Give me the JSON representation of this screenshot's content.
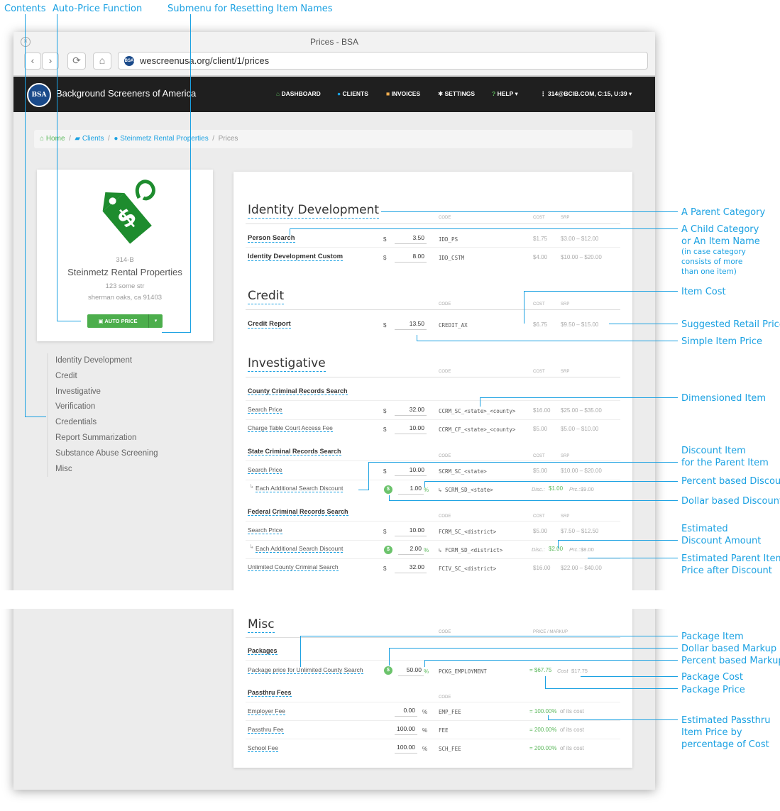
{
  "annotations_top": {
    "contents": "Contents",
    "auto_price": "Auto-Price Function",
    "submenu": "Submenu for Resetting Item Names"
  },
  "annotations_right": {
    "parent_category": "A Parent Category",
    "child_category_1": "A Child Category",
    "child_category_2": "or An Item Name",
    "child_note_1": "(in case category",
    "child_note_2": "consists of more",
    "child_note_3": "than one item)",
    "item_cost": "Item Cost",
    "srp": "Suggested Retail Price",
    "simple_price": "Simple Item Price",
    "dimensioned": "Dimensioned Item",
    "discount_item_1": "Discount Item",
    "discount_item_2": "for the Parent Item",
    "percent_discount": "Percent based Discount",
    "dollar_discount": "Dollar based Discount",
    "est_discount_1": "Estimated",
    "est_discount_2": "Discount Amount",
    "est_parent_1": "Estimated Parent Item",
    "est_parent_2": "Price after Discount",
    "package_item": "Package Item",
    "dollar_markup": "Dollar based Markup",
    "percent_markup": "Percent based Markup",
    "package_cost": "Package Cost",
    "package_price": "Package Price",
    "est_passthru_1": "Estimated Passthru",
    "est_passthru_2": "Item Price by",
    "est_passthru_3": "percentage of Cost"
  },
  "window": {
    "title": "Prices - BSA",
    "close": "×",
    "back": "‹",
    "forward": "›",
    "reload": "⟳",
    "home": "⌂",
    "url": "wescreenusa.org/client/1/prices",
    "url_icon": "BSA"
  },
  "navbar": {
    "logo": "BSA",
    "brand": "Background Screeners of America",
    "dashboard": "DASHBOARD",
    "clients": "CLIENTS",
    "invoices": "INVOICES",
    "settings": "SETTINGS",
    "help": "HELP ▾",
    "account": "314@BCIB.COM, C:15, U:39 ▾"
  },
  "breadcrumb": {
    "home": "Home",
    "clients": "Clients",
    "client": "Steinmetz Rental Properties",
    "current": "Prices",
    "sep": "/"
  },
  "client_card": {
    "id": "314-B",
    "name": "Steinmetz Rental Properties",
    "street": "123 some str",
    "city": "sherman oaks, ca 91403",
    "auto_price": "AUTO PRICE",
    "caret": "▾"
  },
  "contents": [
    "Identity Development",
    "Credit",
    "Investigative",
    "Verification",
    "Credentials",
    "Report Summarization",
    "Substance Abuse Screening",
    "Misc"
  ],
  "cols": {
    "code": "CODE",
    "cost": "COST",
    "srp": "SRP",
    "price_markup": "PRICE / MARKUP"
  },
  "identity": {
    "title": "Identity Development",
    "rows": [
      {
        "name": "Person Search",
        "dollar": "$",
        "price": "3.50",
        "code": "IDD_PS",
        "cost": "$1.75",
        "srp": "$3.00 – $12.00"
      },
      {
        "name": "Identity Development Custom",
        "dollar": "$",
        "price": "8.00",
        "code": "IDD_CSTM",
        "cost": "$4.00",
        "srp": "$10.00 – $20.00"
      }
    ]
  },
  "credit": {
    "title": "Credit",
    "rows": [
      {
        "name": "Credit Report",
        "dollar": "$",
        "price": "13.50",
        "code": "CREDIT_AX",
        "cost": "$6.75",
        "srp": "$9.50 – $15.00"
      }
    ]
  },
  "investigative": {
    "title": "Investigative",
    "county": {
      "title": "County Criminal Records Search",
      "rows": [
        {
          "name": "Search Price",
          "dollar": "$",
          "price": "32.00",
          "code": "CCRM_SC_<state>_<county>",
          "cost": "$16.00",
          "srp": "$25.00 – $35.00"
        },
        {
          "name": "Charge Table Court Access Fee",
          "dollar": "$",
          "price": "10.00",
          "code": "CCRM_CF_<state>_<county>",
          "cost": "$5.00",
          "srp": "$5.00 – $10.00"
        }
      ]
    },
    "state": {
      "title": "State Criminal Records Search",
      "rows": [
        {
          "name": "Search Price",
          "dollar": "$",
          "price": "10.00",
          "code": "SCRM_SC_<state>",
          "cost": "$5.00",
          "srp": "$10.00 – $20.00"
        }
      ],
      "discount": {
        "arrow": "↳",
        "name": "Each Additional Search Discount",
        "coin": "$",
        "price": "1.00",
        "pct": "%",
        "code": "↳ SCRM_SD_<state>",
        "disc_label": "Disc.:",
        "disc": "$1.00",
        "prc_label": "Prc.:",
        "prc": "$9.00"
      }
    },
    "federal": {
      "title": "Federal Criminal Records Search",
      "rows": [
        {
          "name": "Search Price",
          "dollar": "$",
          "price": "10.00",
          "code": "FCRM_SC_<district>",
          "cost": "$5.00",
          "srp": "$7.50 – $12.50"
        }
      ],
      "discount": {
        "arrow": "↳",
        "name": "Each Additional Search Discount",
        "coin": "$",
        "price": "2.00",
        "pct": "%",
        "code": "↳ FCRM_SD_<district>",
        "disc_label": "Disc.:",
        "disc": "$2.00",
        "prc_label": "Prc.:",
        "prc": "$8.00"
      },
      "unlimited": {
        "name": "Unlimited County Criminal Search",
        "dollar": "$",
        "price": "32.00",
        "code": "FCIV_SC_<district>",
        "cost": "$16.00",
        "srp": "$22.00 – $40.00"
      }
    }
  },
  "misc": {
    "title": "Misc",
    "packages": {
      "title": "Packages",
      "row": {
        "name": "Package price for Unlimited County Search",
        "coin": "$",
        "price": "50.00",
        "pct": "%",
        "code": "PCKG_EMPLOYMENT",
        "price_eq": "= $67.75",
        "cost_label": "Cost",
        "cost": "$17.75"
      }
    },
    "passthru": {
      "title": "Passthru Fees",
      "rows": [
        {
          "name": "Employer Fee",
          "price": "0.00",
          "pct": "%",
          "code": "EMP_FEE",
          "est": "= 100.00%",
          "suffix": "of its cost"
        },
        {
          "name": "Passthru Fee",
          "price": "100.00",
          "pct": "%",
          "code": "FEE",
          "est": "= 200.00%",
          "suffix": "of its cost"
        },
        {
          "name": "School Fee",
          "price": "100.00",
          "pct": "%",
          "code": "SCH_FEE",
          "est": "= 200.00%",
          "suffix": "of its cost"
        }
      ]
    }
  },
  "colors": {
    "annotation": "#1ba1e2",
    "green": "#5cb85c",
    "navbar": "#1f1f1f"
  }
}
